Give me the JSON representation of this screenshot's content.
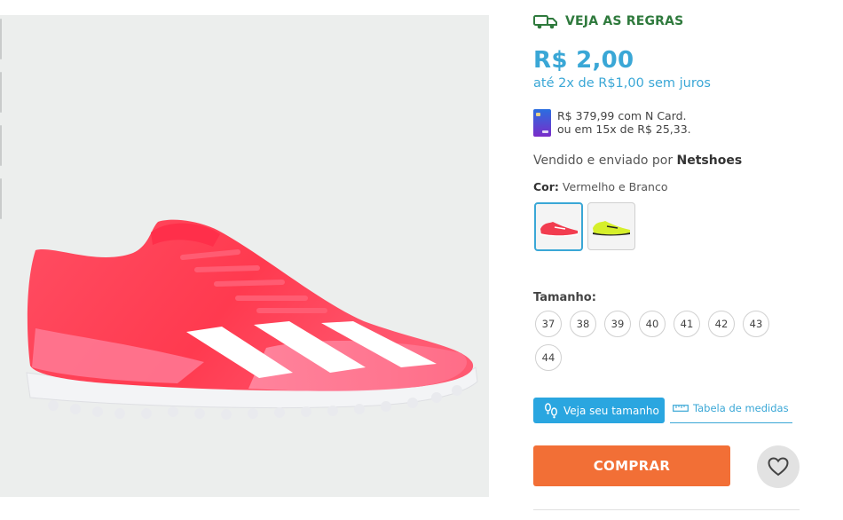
{
  "shipping": {
    "label": "VEJA AS REGRAS",
    "icon": "truck-icon"
  },
  "price": {
    "main": "R$ 2,00",
    "installments": "até 2x de R$1,00 sem juros"
  },
  "ncard": {
    "line1": "R$ 379,99 com N Card.",
    "line2": "ou em 15x de R$ 25,33.",
    "icon": "card-icon"
  },
  "seller": {
    "prefix": "Vendido e enviado por",
    "name": "Netshoes"
  },
  "color": {
    "label": "Cor:",
    "value": "Vermelho e Branco",
    "options": [
      {
        "name": "red",
        "accent": "#f23c4f"
      },
      {
        "name": "yellow",
        "accent": "#d6ef2b"
      }
    ]
  },
  "sizes": {
    "title": "Tamanho:",
    "options": [
      "37",
      "38",
      "39",
      "40",
      "41",
      "42",
      "43",
      "44"
    ]
  },
  "size_tools": {
    "see_size": "Veja seu tamanho",
    "size_table": "Tabela de medidas"
  },
  "actions": {
    "buy": "COMPRAR",
    "wishlist_icon": "heart-icon"
  },
  "colors": {
    "accent": "#3aa7d6",
    "buy": "#f26f36",
    "rules": "#2f7a3d"
  }
}
